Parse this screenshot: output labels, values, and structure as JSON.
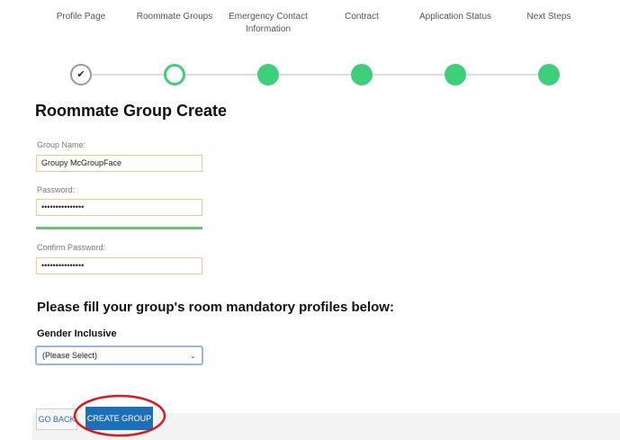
{
  "steps": [
    {
      "label": "Profile Page",
      "state": "done"
    },
    {
      "label": "Roommate Groups",
      "state": "current"
    },
    {
      "label": "Emergency Contact Information",
      "state": "todo"
    },
    {
      "label": "Contract",
      "state": "todo"
    },
    {
      "label": "Application Status",
      "state": "todo"
    },
    {
      "label": "Next Steps",
      "state": "todo"
    }
  ],
  "check_glyph": "✔",
  "page_title": "Roommate Group Create",
  "form": {
    "group_name_label": "Group Name:",
    "group_name_value": "Groupy McGroupFace",
    "password_label": "Password:",
    "password_value": "•••••••••••••••",
    "confirm_label": "Confirm Password:",
    "confirm_value": "•••••••••••••••"
  },
  "profiles": {
    "heading": "Please fill your group's room mandatory profiles below:",
    "gender_label": "Gender Inclusive",
    "gender_selected": "(Please Select)",
    "chevron": "⌄"
  },
  "actions": {
    "back_label": "GO BACK",
    "create_label": "CREATE GROUP"
  },
  "colors": {
    "step_green": "#3ecf7a",
    "primary_blue": "#1d6fb8",
    "annotation_red": "#d9191c"
  }
}
